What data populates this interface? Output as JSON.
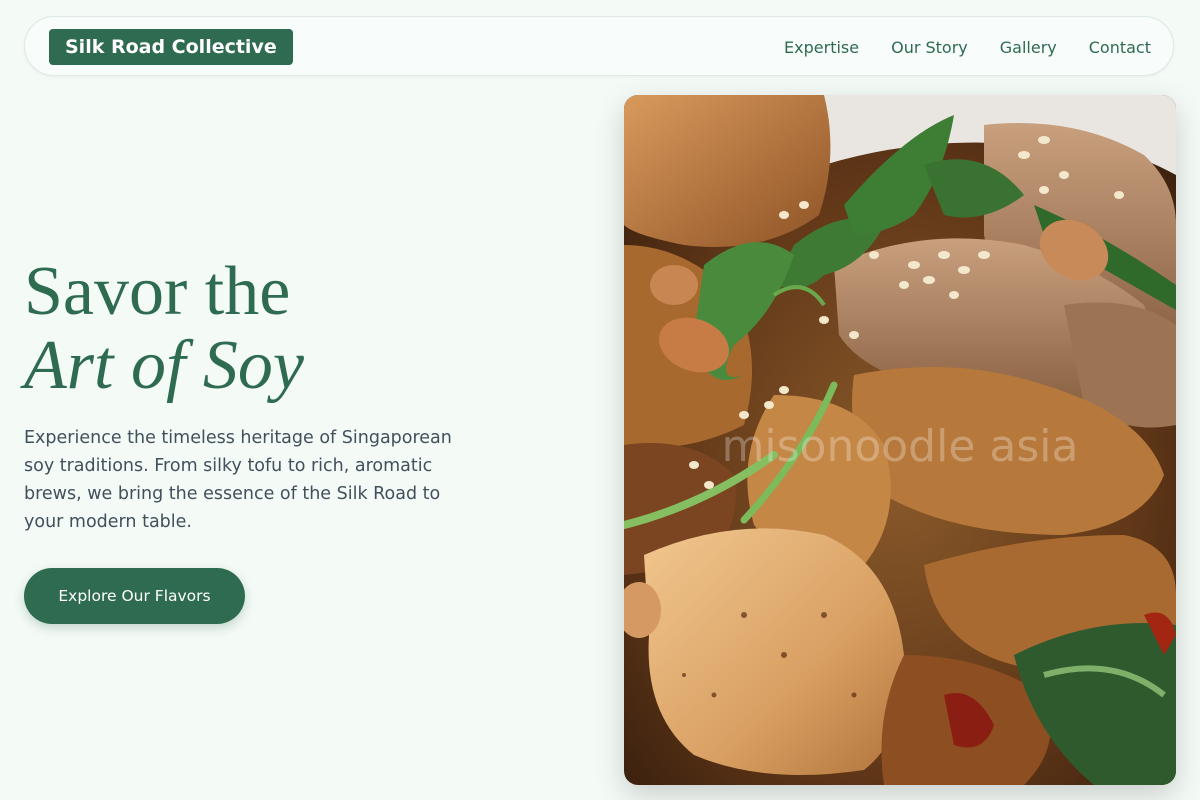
{
  "header": {
    "logo": "Silk Road Collective",
    "nav": [
      {
        "label": "Expertise"
      },
      {
        "label": "Our Story"
      },
      {
        "label": "Gallery"
      },
      {
        "label": "Contact"
      }
    ]
  },
  "hero": {
    "title_line1": "Savor the",
    "title_line2": "Art of Soy",
    "description": "Experience the timeless heritage of Singaporean soy traditions. From silky tofu to rich, aromatic brews, we bring the essence of the Silk Road to your modern table.",
    "cta_label": "Explore Our Flavors",
    "image": {
      "subject": "stir-fried tofu and beef with peanuts, sesame and cilantro",
      "watermark": "misonoodle asia"
    }
  },
  "colors": {
    "accent": "#2e6b51",
    "background": "#f4faf6",
    "body_text": "#41505d"
  }
}
